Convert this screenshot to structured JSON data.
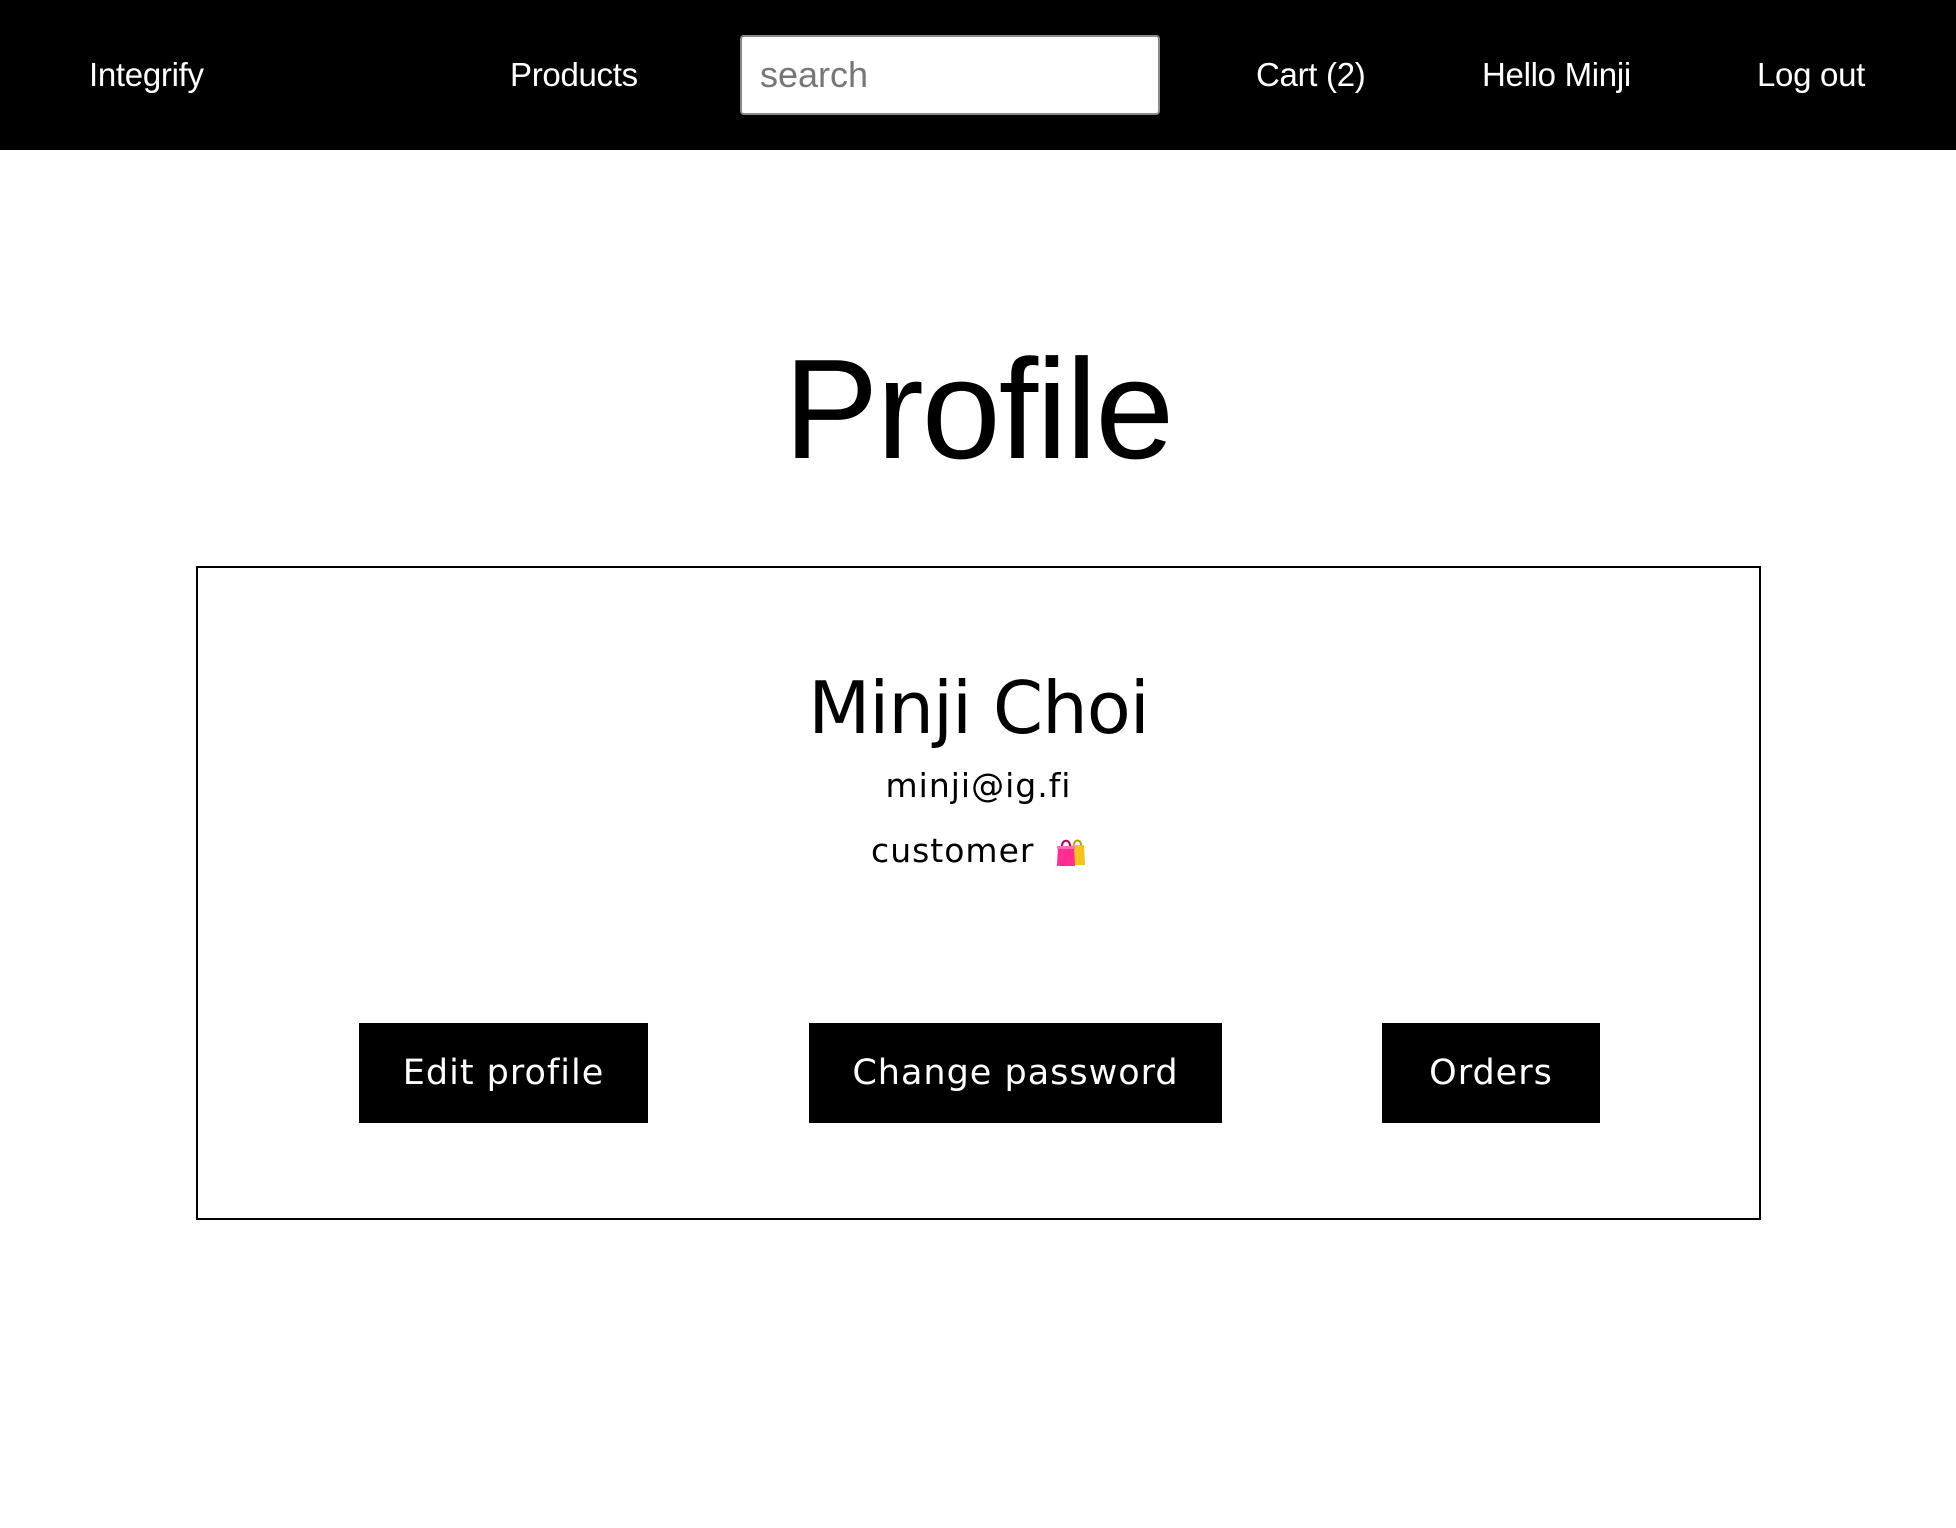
{
  "navbar": {
    "brand": "Integrify",
    "products_label": "Products",
    "search_placeholder": "search",
    "search_value": "",
    "cart_label": "Cart (2)",
    "greeting": "Hello Minji",
    "logout_label": "Log out"
  },
  "page": {
    "title": "Profile"
  },
  "profile": {
    "name": "Minji Choi",
    "email": "minji@ig.fi",
    "role": "customer",
    "role_icon": "shopping-bags-icon"
  },
  "actions": {
    "edit_label": "Edit profile",
    "password_label": "Change password",
    "orders_label": "Orders"
  },
  "colors": {
    "nav_background": "#000000",
    "button_background": "#000000",
    "button_text": "#ffffff",
    "bag_pink": "#ff2d8f",
    "bag_yellow": "#f6c21b"
  }
}
